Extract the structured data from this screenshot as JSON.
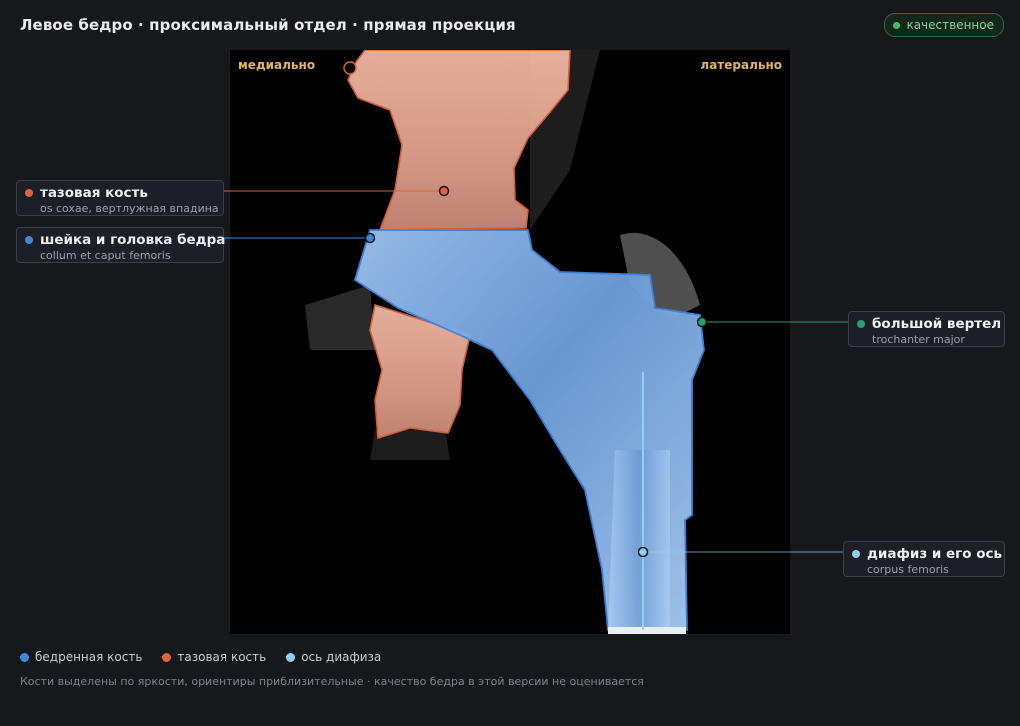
{
  "header": {
    "title": "Левое бедро · проксимальный отдел · прямая проекция",
    "badge_label": "качественное"
  },
  "viewer": {
    "orientation_left": "медиально",
    "orientation_right": "латерально"
  },
  "callouts": [
    {
      "name": "тазовая кость",
      "latin": "os coxae, вертлужная впадина",
      "color": "#e0643a"
    },
    {
      "name": "шейка и головка бедра",
      "latin": "collum et caput femoris",
      "color": "#3f86e0"
    },
    {
      "name": "большой вертел",
      "latin": "trochanter major",
      "color": "#23a26d"
    },
    {
      "name": "диафиз и его ось",
      "latin": "corpus femoris",
      "color": "#8fd0f5"
    }
  ],
  "legend": [
    {
      "label": "бедренная кость",
      "color": "#3f86e0"
    },
    {
      "label": "тазовая кость",
      "color": "#e0643a"
    },
    {
      "label": "ось диафиза",
      "color": "#8fd0f5"
    }
  ],
  "footnote": "Кости выделены по яркости, ориентиры приблизительные · качество бедра в этой версии не оценивается",
  "colors": {
    "background": "#16181c",
    "femur": "#3f86e0",
    "pelvis": "#e0643a",
    "shaft_axis": "#8fd0f5",
    "trochanter": "#23a26d",
    "badge": "#3fbf6a"
  }
}
